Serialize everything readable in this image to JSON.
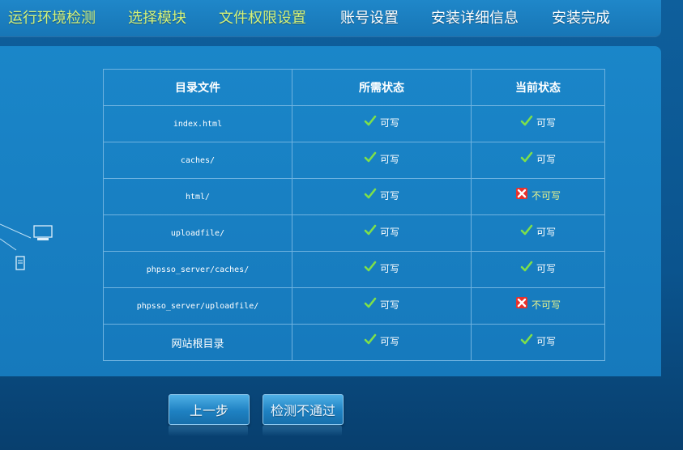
{
  "steps": [
    {
      "label": "运行环境检测",
      "state": "done"
    },
    {
      "label": "选择模块",
      "state": "done"
    },
    {
      "label": "文件权限设置",
      "state": "done"
    },
    {
      "label": "账号设置",
      "state": "todo"
    },
    {
      "label": "安装详细信息",
      "state": "todo"
    },
    {
      "label": "安装完成",
      "state": "todo"
    }
  ],
  "table": {
    "headers": [
      "目录文件",
      "所需状态",
      "当前状态"
    ],
    "rows": [
      {
        "path": "index.html",
        "required": "可写",
        "current": "可写",
        "current_ok": true
      },
      {
        "path": "caches/",
        "required": "可写",
        "current": "可写",
        "current_ok": true
      },
      {
        "path": "html/",
        "required": "可写",
        "current": "不可写",
        "current_ok": false
      },
      {
        "path": "uploadfile/",
        "required": "可写",
        "current": "可写",
        "current_ok": true
      },
      {
        "path": "phpsso_server/caches/",
        "required": "可写",
        "current": "可写",
        "current_ok": true
      },
      {
        "path": "phpsso_server/uploadfile/",
        "required": "可写",
        "current": "不可写",
        "current_ok": false
      },
      {
        "path": "网站根目录",
        "required": "可写",
        "current": "可写",
        "current_ok": true
      }
    ]
  },
  "buttons": {
    "prev_label": "上一步",
    "next_label": "检测不通过"
  },
  "colors": {
    "step_done": "#d4f27a",
    "step_todo": "#ffffff",
    "ok_icon": "#7ee04a",
    "bad_icon": "#e8322c",
    "bad_text": "#e6f28c"
  },
  "icons": {
    "ok": "check-icon",
    "bad": "cross-icon",
    "network": "network-computer-icon"
  }
}
